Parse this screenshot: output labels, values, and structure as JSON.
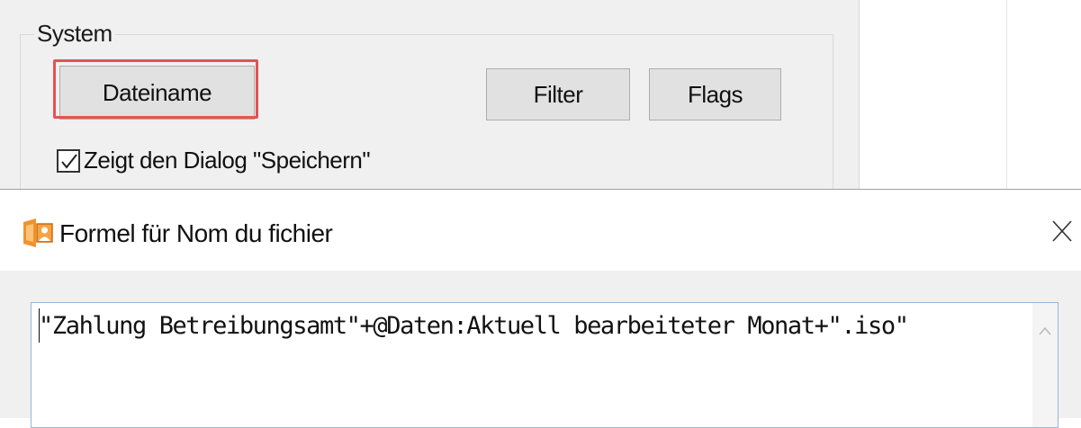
{
  "background_dialog": {
    "group_title": "System",
    "buttons": {
      "dateiname": "Dateiname",
      "filter": "Filter",
      "flags": "Flags"
    },
    "checkbox": {
      "label": "Zeigt den Dialog \"Speichern\"",
      "checked": true
    },
    "highlight_color": "#e25454"
  },
  "formula_dialog": {
    "title": "Formel für Nom du fichier",
    "icon": "app-icon",
    "close_icon": "close-icon",
    "formula": "\"Zahlung Betreibungsamt\"+@Daten:Aktuell bearbeiteter Monat+\".iso\"",
    "input_border_color": "#9ab4d6"
  }
}
